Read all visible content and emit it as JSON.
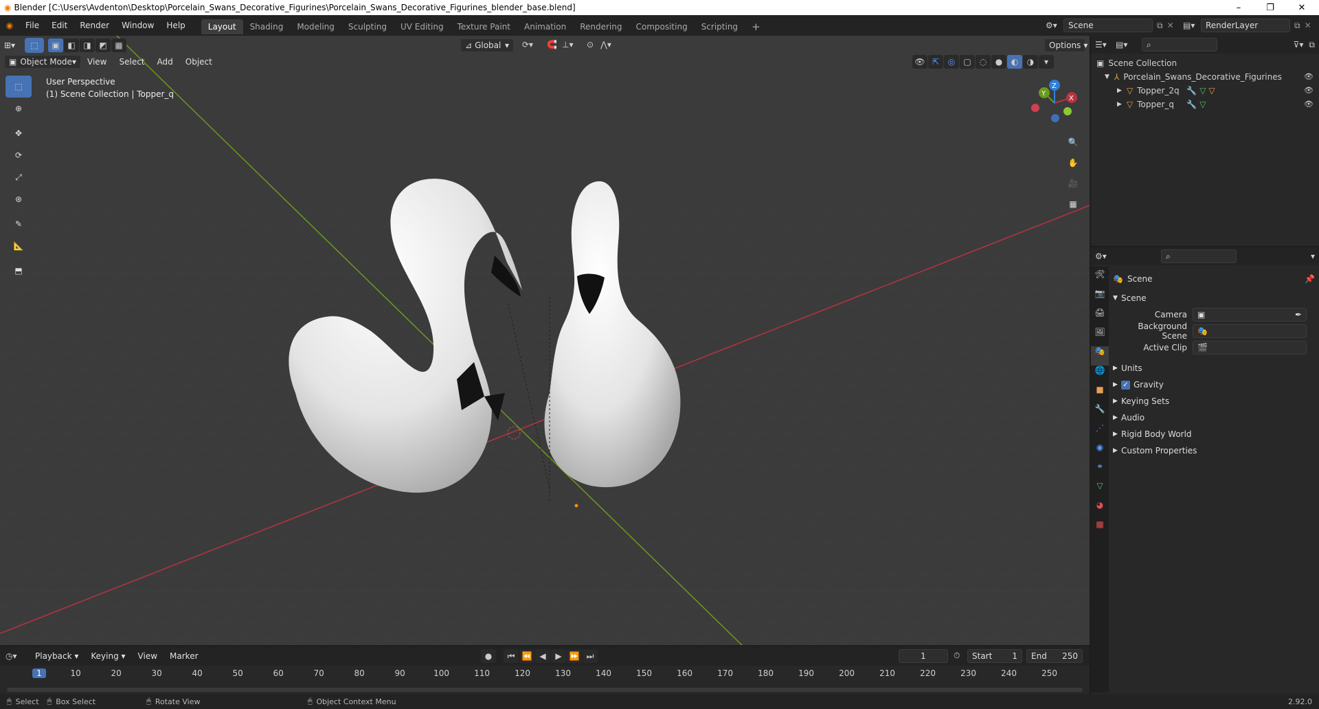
{
  "window": {
    "title": "Blender [C:\\Users\\Avdenton\\Desktop\\Porcelain_Swans_Decorative_Figurines\\Porcelain_Swans_Decorative_Figurines_blender_base.blend]",
    "minimize": "–",
    "maximize": "❐",
    "close": "✕"
  },
  "menubar": [
    "File",
    "Edit",
    "Render",
    "Window",
    "Help"
  ],
  "workspace_tabs": [
    "Layout",
    "Shading",
    "Modeling",
    "Sculpting",
    "UV Editing",
    "Texture Paint",
    "Animation",
    "Rendering",
    "Compositing",
    "Scripting"
  ],
  "active_tab": "Layout",
  "add_tab": "+",
  "scene_field": "Scene",
  "renderlayer_field": "RenderLayer",
  "viewport": {
    "transform_orientation": "Global",
    "options_label": "Options",
    "mode": "Object Mode",
    "header_menus": [
      "View",
      "Select",
      "Add",
      "Object"
    ],
    "overlay_line1": "User Perspective",
    "overlay_line2": "(1) Scene Collection | Topper_q",
    "gizmo_labels": {
      "x": "X",
      "y": "Y",
      "z": "Z"
    }
  },
  "outliner": {
    "root": "Scene Collection",
    "collection": "Porcelain_Swans_Decorative_Figurines",
    "items": [
      {
        "name": "Topper_2q"
      },
      {
        "name": "Topper_q"
      }
    ]
  },
  "properties": {
    "header": "Scene",
    "panel": "Scene",
    "fields": [
      {
        "label": "Camera",
        "value": ""
      },
      {
        "label": "Background Scene",
        "value": ""
      },
      {
        "label": "Active Clip",
        "value": ""
      }
    ],
    "sections": [
      {
        "label": "Units",
        "checkbox": false
      },
      {
        "label": "Gravity",
        "checkbox": true
      },
      {
        "label": "Keying Sets",
        "checkbox": false
      },
      {
        "label": "Audio",
        "checkbox": false
      },
      {
        "label": "Rigid Body World",
        "checkbox": false
      },
      {
        "label": "Custom Properties",
        "checkbox": false
      }
    ]
  },
  "timeline": {
    "menus": [
      "Playback",
      "Keying",
      "View",
      "Marker"
    ],
    "current_frame": "1",
    "start_label": "Start",
    "start": "1",
    "end_label": "End",
    "end": "250",
    "ruler": [
      "1",
      "10",
      "20",
      "30",
      "40",
      "50",
      "60",
      "70",
      "80",
      "90",
      "100",
      "110",
      "120",
      "130",
      "140",
      "150",
      "160",
      "170",
      "180",
      "190",
      "200",
      "210",
      "220",
      "230",
      "240",
      "250"
    ]
  },
  "statusbar": {
    "items": [
      "Select",
      "Box Select",
      "Rotate View",
      "Object Context Menu"
    ],
    "version": "2.92.0"
  },
  "colors": {
    "accent": "#4772b3",
    "x_axis": "#b8333f",
    "y_axis": "#6a9a1f",
    "z_axis": "#2f7fd6",
    "origin": "#ff8c00"
  }
}
